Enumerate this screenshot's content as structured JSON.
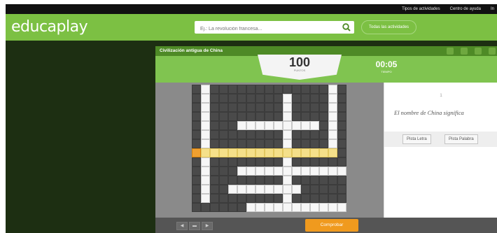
{
  "topbar": {
    "links": [
      "Tipos de actividades",
      "Centro de ayuda",
      "In"
    ]
  },
  "header": {
    "logo": "educaplay",
    "search_placeholder": "Ej.: La revolución francesa...",
    "all_activities": "Todas las actividades"
  },
  "game": {
    "title": "Civilización antigua de China",
    "score": {
      "value": "100",
      "label": "PUNTOS"
    },
    "timer": {
      "value": "00:05",
      "label": "TIEMPO"
    },
    "clue": {
      "number": "1",
      "text": "El nombre de China significa"
    },
    "hints": {
      "letter": "Pista Letra",
      "word": "Pista Palabra"
    },
    "check_button": "Comprobar",
    "nav": [
      "◀",
      "▬",
      "▶"
    ]
  },
  "colors": {
    "brand_green": "#7cc043",
    "dark_green": "#4e8a26",
    "accent_orange": "#f09a1e",
    "active_word": "#f5e08a"
  }
}
